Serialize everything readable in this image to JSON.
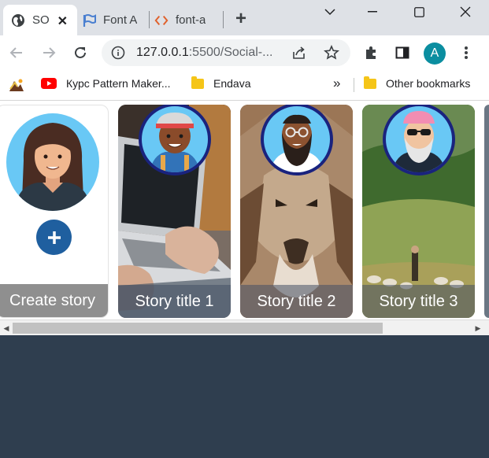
{
  "browser": {
    "tabs": [
      {
        "label": "SO",
        "icon": "globe-icon",
        "active": true
      },
      {
        "label": "Font A",
        "icon": "flag-icon",
        "active": false
      },
      {
        "label": "font-a",
        "icon": "code-icon",
        "active": false
      }
    ],
    "new_tab_label": "+",
    "url_host": "127.0.0.1",
    "url_rest": ":5500/Social-..."
  },
  "profile": {
    "initial": "A"
  },
  "bookmarks": {
    "items": [
      {
        "label": "Курс Pattern Maker...",
        "icon": "youtube-icon"
      },
      {
        "label": "Endava",
        "icon": "folder-icon"
      }
    ],
    "overflow_label": "»",
    "other_label": "Other bookmarks"
  },
  "stories": {
    "create_label": "Create story",
    "cards": [
      {
        "title": "Story title 1",
        "background": "laptop-photo",
        "avatar": "worker-avatar"
      },
      {
        "title": "Story title 2",
        "background": "coyote-photo",
        "avatar": "bearded-man-avatar"
      },
      {
        "title": "Story title 3",
        "background": "pasture-photo",
        "avatar": "elder-man-avatar"
      }
    ]
  },
  "colors": {
    "page_bg": "#2f3e4f",
    "avatar_ring": "#1a237e",
    "plus_button": "#1f5f9f",
    "profile_avatar": "#0b8ea0"
  }
}
